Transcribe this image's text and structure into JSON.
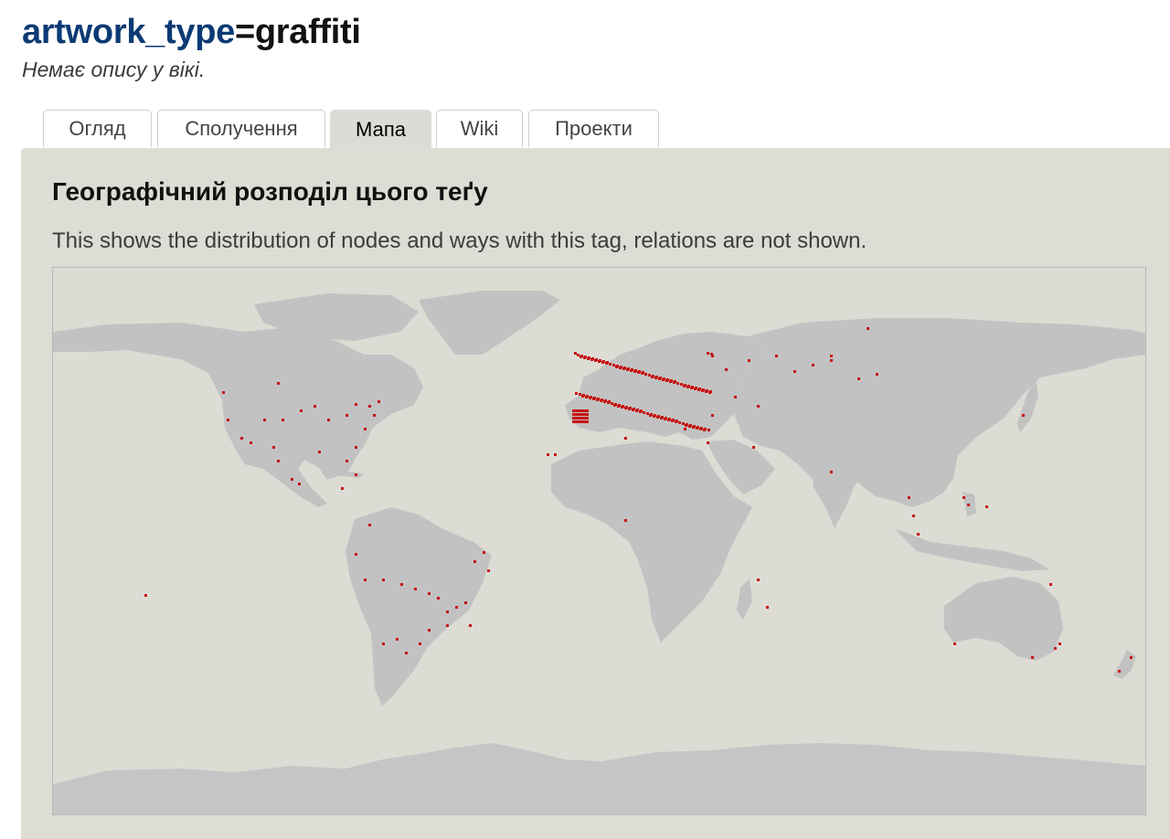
{
  "header": {
    "key": "artwork_type",
    "equals": "=",
    "value": "graffiti",
    "description": "Немає опису у вікі."
  },
  "tabs": [
    {
      "label": "Огляд",
      "active": false
    },
    {
      "label": "Сполучення",
      "active": false
    },
    {
      "label": "Мапа",
      "active": true
    },
    {
      "label": "Wiki",
      "active": false
    },
    {
      "label": "Проекти",
      "active": false
    }
  ],
  "panel": {
    "heading": "Географічний розподіл цього теґу",
    "description": "This shows the distribution of nodes and ways with this tag, relations are not shown."
  },
  "colors": {
    "key": "#0b3a74",
    "panel_background": "#dddcd5",
    "land": "#c2c2c2",
    "marker": "#c81414"
  }
}
